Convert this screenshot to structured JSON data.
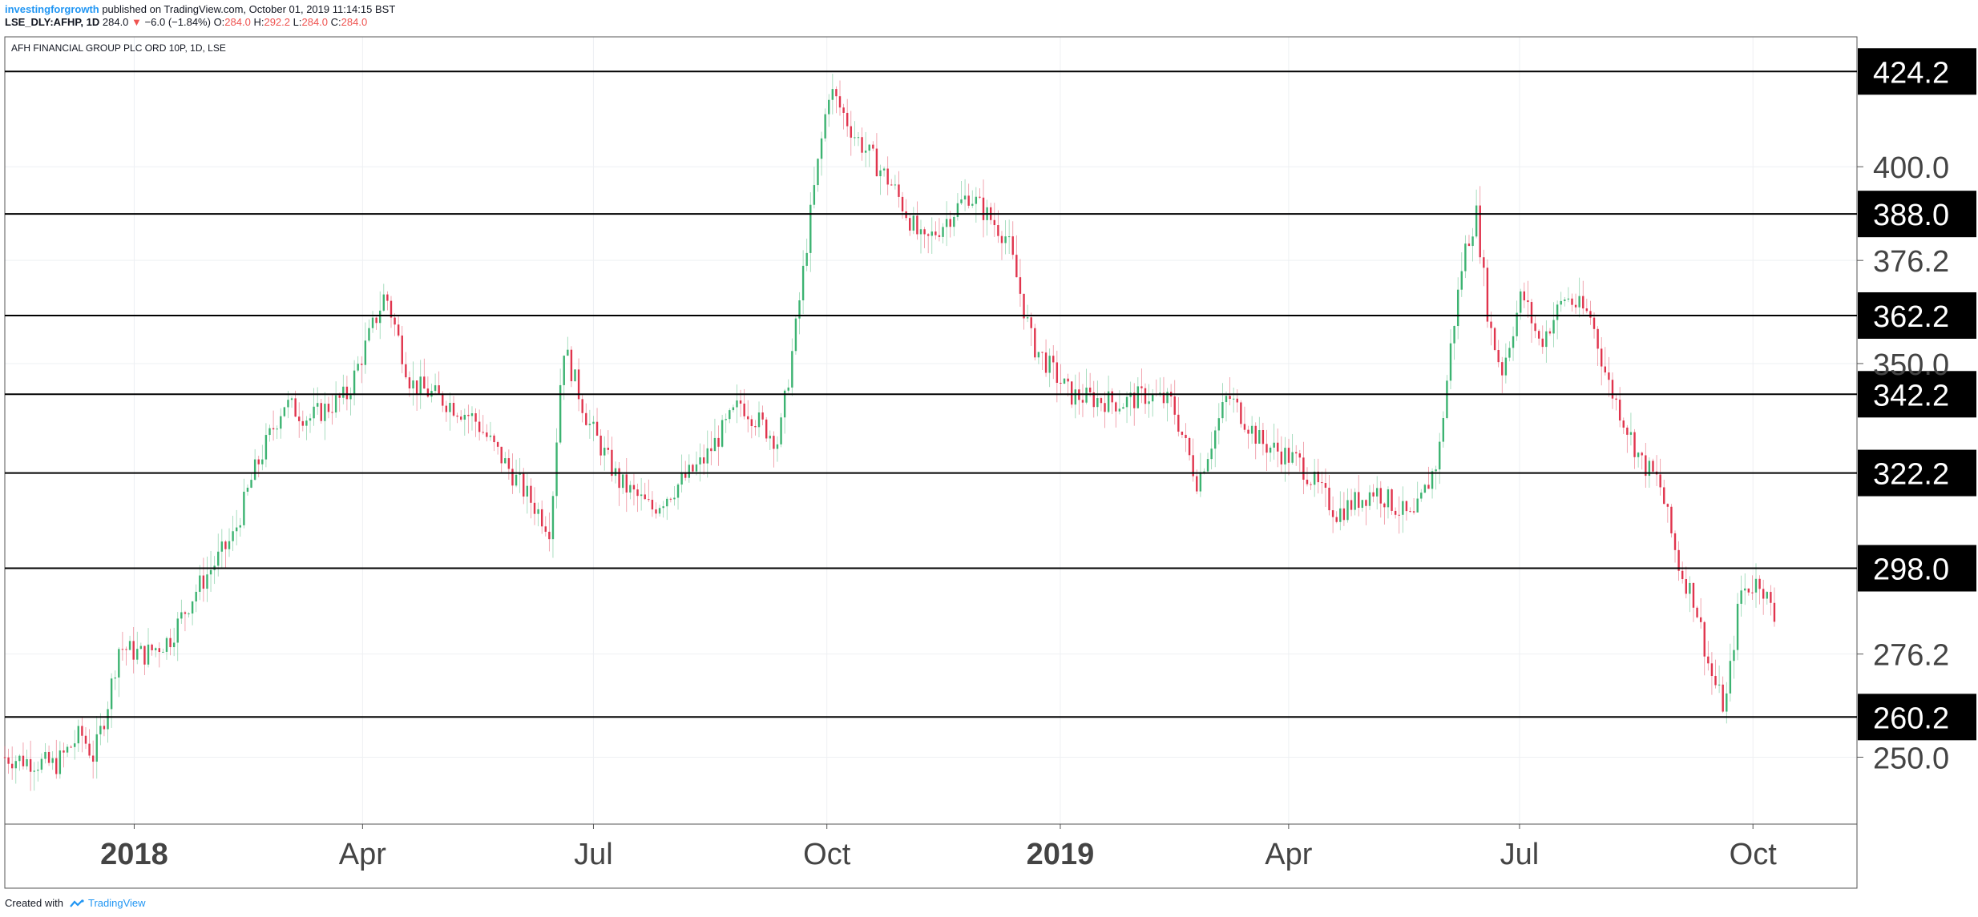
{
  "header": {
    "author": "investingforgrowth",
    "published": " published on TradingView.com, October 01, 2019 11:14:15 BST",
    "symbol": "LSE_DLY:AFHP, 1D",
    "last": "284.0",
    "change": "−6.0 (−1.84%)",
    "o_label": "O:",
    "o": "284.0",
    "h_label": "H:",
    "h": "292.2",
    "l_label": "L:",
    "l": "284.0",
    "c_label": "C:",
    "c": "284.0"
  },
  "footer": {
    "created_with": "Created with",
    "brand": "TradingView"
  },
  "colors": {
    "up": "#26a69a",
    "up_candle": "#3cb371",
    "down": "#e0344d",
    "grid": "#eef0f3",
    "line": "#000000",
    "text": "#444444"
  },
  "chart_data": {
    "type": "candlestick",
    "title": "AFH FINANCIAL GROUP PLC ORD 10P, 1D, LSE",
    "y_ticks": [
      250.0,
      276.2,
      350.0,
      376.2,
      400.0
    ],
    "y_tick_labels": [
      "250.0",
      "276.2",
      "350.0",
      "376.2",
      "400.0"
    ],
    "horizontal_levels": [
      424.2,
      388.0,
      362.2,
      342.2,
      322.2,
      298.0,
      260.2
    ],
    "horizontal_level_labels": [
      "424.2",
      "388.0",
      "362.2",
      "342.2",
      "322.2",
      "298.0",
      "260.2"
    ],
    "x_tick_labels": [
      "2018",
      "Apr",
      "Jul",
      "Oct",
      "2019",
      "Apr",
      "Jul",
      "Oct"
    ],
    "x_tick_bold": [
      true,
      false,
      false,
      false,
      true,
      false,
      false,
      false
    ],
    "x_tick_days": [
      51,
      141,
      232,
      324,
      416,
      506,
      597,
      689
    ],
    "x_range_days": [
      0,
      730
    ],
    "y_range": [
      233,
      433
    ],
    "grid": true,
    "series_path": [
      [
        0,
        250
      ],
      [
        20,
        248
      ],
      [
        30,
        256
      ],
      [
        35,
        250
      ],
      [
        40,
        262
      ],
      [
        45,
        278
      ],
      [
        55,
        276
      ],
      [
        65,
        280
      ],
      [
        75,
        292
      ],
      [
        90,
        306
      ],
      [
        98,
        322
      ],
      [
        110,
        340
      ],
      [
        120,
        336
      ],
      [
        135,
        342
      ],
      [
        150,
        368
      ],
      [
        160,
        345
      ],
      [
        175,
        340
      ],
      [
        185,
        336
      ],
      [
        200,
        322
      ],
      [
        215,
        308
      ],
      [
        220,
        355
      ],
      [
        230,
        335
      ],
      [
        242,
        320
      ],
      [
        255,
        313
      ],
      [
        275,
        325
      ],
      [
        290,
        340
      ],
      [
        305,
        330
      ],
      [
        312,
        360
      ],
      [
        318,
        390
      ],
      [
        325,
        420
      ],
      [
        335,
        408
      ],
      [
        350,
        395
      ],
      [
        362,
        380
      ],
      [
        380,
        393
      ],
      [
        395,
        382
      ],
      [
        405,
        355
      ],
      [
        420,
        342
      ],
      [
        440,
        340
      ],
      [
        450,
        342
      ],
      [
        460,
        340
      ],
      [
        470,
        320
      ],
      [
        482,
        342
      ],
      [
        495,
        330
      ],
      [
        510,
        325
      ],
      [
        525,
        312
      ],
      [
        540,
        318
      ],
      [
        555,
        310
      ],
      [
        565,
        326
      ],
      [
        570,
        355
      ],
      [
        575,
        378
      ],
      [
        580,
        388
      ],
      [
        585,
        360
      ],
      [
        590,
        348
      ],
      [
        598,
        368
      ],
      [
        605,
        355
      ],
      [
        615,
        367
      ],
      [
        625,
        362
      ],
      [
        632,
        345
      ],
      [
        645,
        325
      ],
      [
        652,
        320
      ],
      [
        660,
        298
      ],
      [
        666,
        290
      ],
      [
        672,
        272
      ],
      [
        678,
        262
      ],
      [
        684,
        292
      ],
      [
        692,
        295
      ],
      [
        698,
        284
      ]
    ]
  }
}
